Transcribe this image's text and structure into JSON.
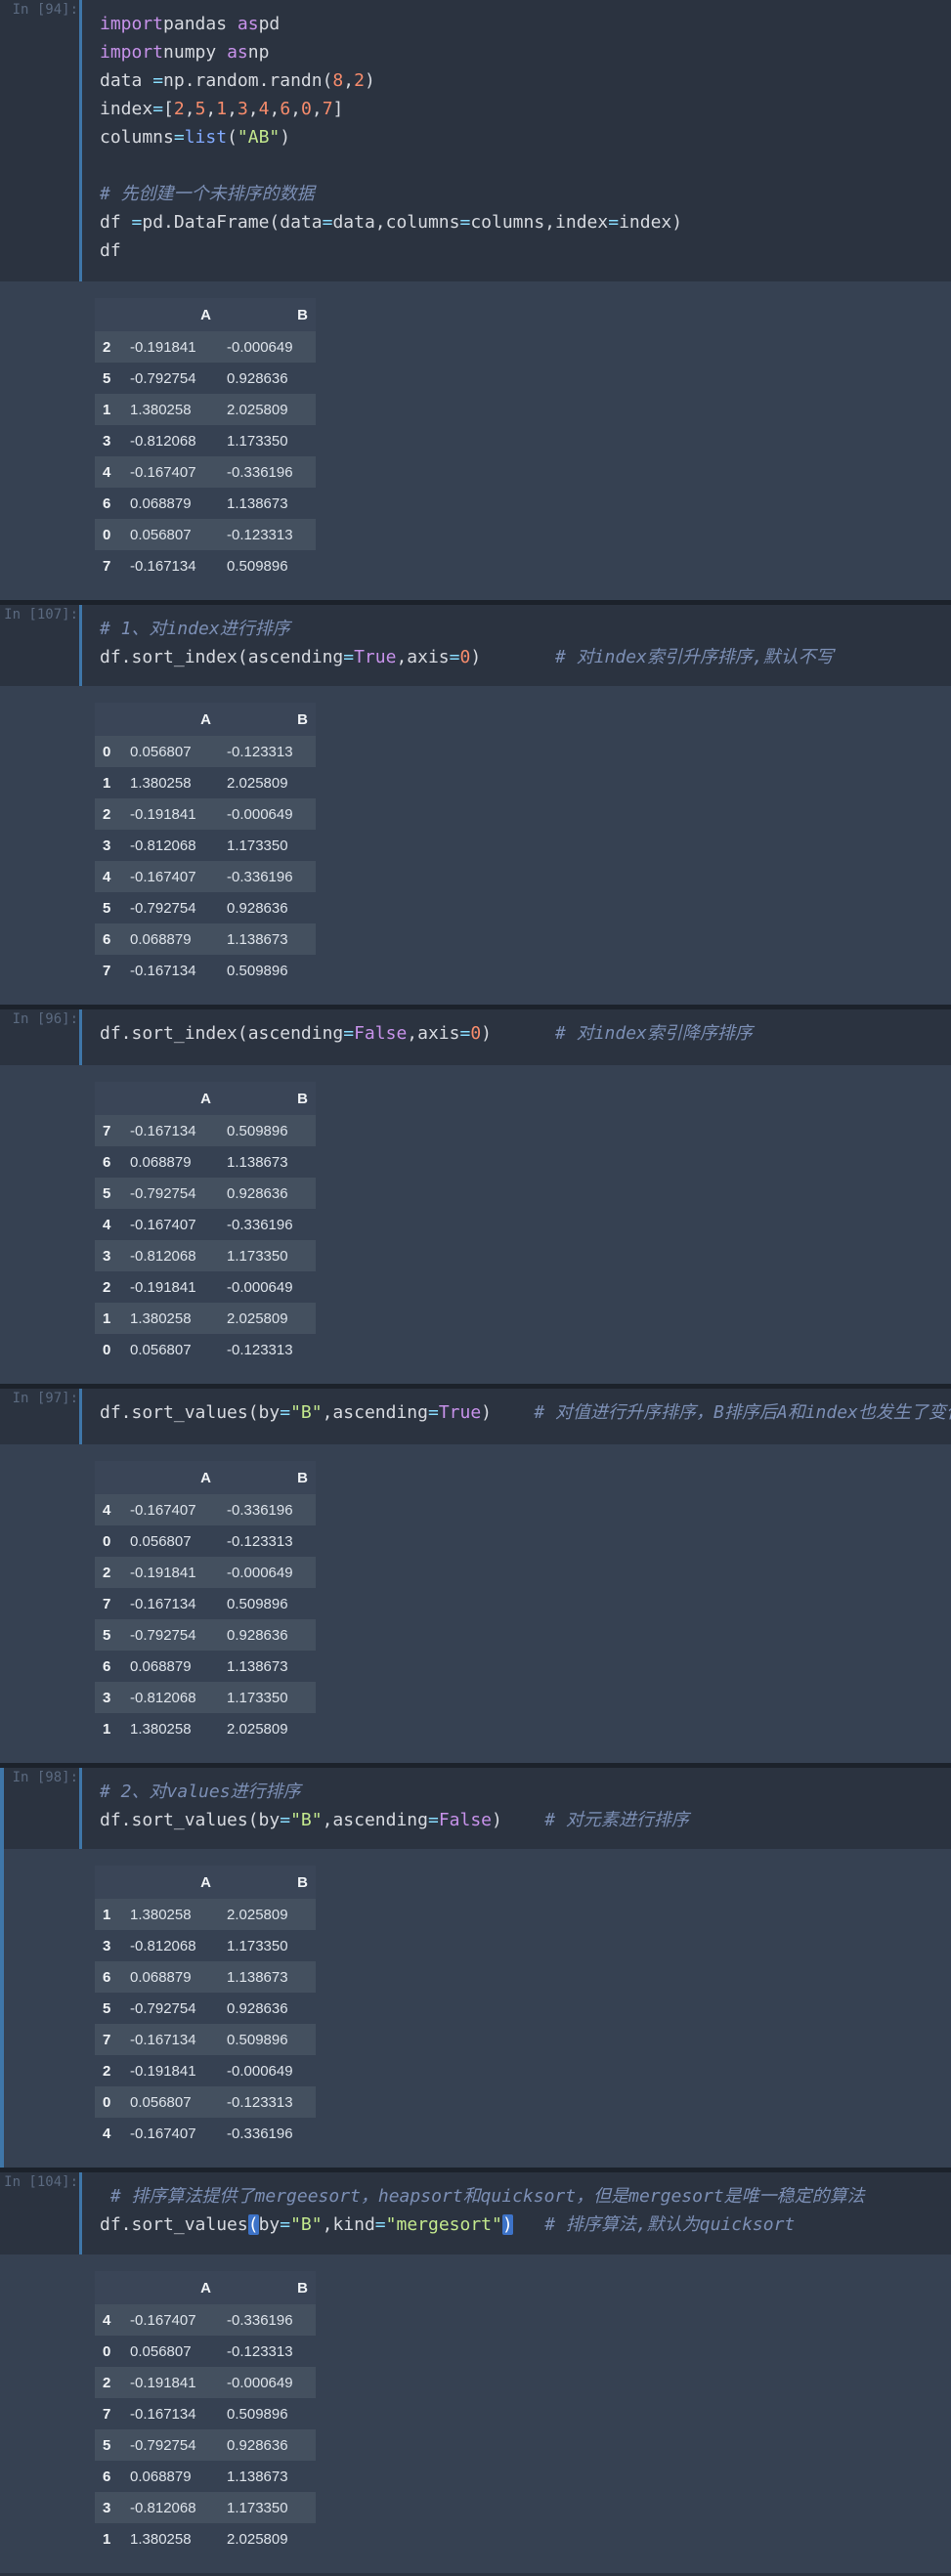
{
  "cells": [
    {
      "prompt": "In [94]:",
      "code": [
        [
          [
            "kw",
            "import"
          ],
          [
            "",
            "pandas "
          ],
          [
            "kw",
            "as"
          ],
          [
            "",
            "pd"
          ]
        ],
        [
          [
            "kw",
            "import"
          ],
          [
            "",
            "numpy "
          ],
          [
            "kw",
            "as"
          ],
          [
            "",
            "np"
          ]
        ],
        [
          [
            "",
            "data "
          ],
          [
            "op",
            "="
          ],
          [
            "",
            "np.random.randn("
          ],
          [
            "num",
            "8"
          ],
          [
            "",
            ","
          ],
          [
            "num",
            "2"
          ],
          [
            "",
            ")"
          ]
        ],
        [
          [
            "",
            "index"
          ],
          [
            "op",
            "="
          ],
          [
            "",
            "["
          ],
          [
            "num",
            "2"
          ],
          [
            "",
            ","
          ],
          [
            "num",
            "5"
          ],
          [
            "",
            ","
          ],
          [
            "num",
            "1"
          ],
          [
            "",
            ","
          ],
          [
            "num",
            "3"
          ],
          [
            "",
            ","
          ],
          [
            "num",
            "4"
          ],
          [
            "",
            ","
          ],
          [
            "num",
            "6"
          ],
          [
            "",
            ","
          ],
          [
            "num",
            "0"
          ],
          [
            "",
            ","
          ],
          [
            "num",
            "7"
          ],
          [
            "",
            "]"
          ]
        ],
        [
          [
            "",
            "columns"
          ],
          [
            "op",
            "="
          ],
          [
            "fn",
            "list"
          ],
          [
            "",
            "("
          ],
          [
            "str",
            "\"AB\""
          ],
          [
            "",
            ")"
          ]
        ],
        [],
        [
          [
            "cm",
            "# 先创建一个未排序的数据"
          ]
        ],
        [
          [
            "",
            "df "
          ],
          [
            "op",
            "="
          ],
          [
            "",
            "pd.DataFrame(data"
          ],
          [
            "op",
            "="
          ],
          [
            "",
            "data,columns"
          ],
          [
            "op",
            "="
          ],
          [
            "",
            "columns,index"
          ],
          [
            "op",
            "="
          ],
          [
            "",
            "index)"
          ]
        ],
        [
          [
            "",
            "df"
          ]
        ]
      ],
      "table": {
        "columns": [
          "A",
          "B"
        ],
        "rows": [
          [
            "2",
            "-0.191841",
            "-0.000649"
          ],
          [
            "5",
            "-0.792754",
            "0.928636"
          ],
          [
            "1",
            "1.380258",
            "2.025809"
          ],
          [
            "3",
            "-0.812068",
            "1.173350"
          ],
          [
            "4",
            "-0.167407",
            "-0.336196"
          ],
          [
            "6",
            "0.068879",
            "1.138673"
          ],
          [
            "0",
            "0.056807",
            "-0.123313"
          ],
          [
            "7",
            "-0.167134",
            "0.509896"
          ]
        ]
      }
    },
    {
      "prompt": "In [107]:",
      "code": [
        [
          [
            "cm",
            "# 1、对index进行排序"
          ]
        ],
        [
          [
            "",
            "df.sort_index(ascending"
          ],
          [
            "op",
            "="
          ],
          [
            "bool",
            "True"
          ],
          [
            "",
            ",axis"
          ],
          [
            "op",
            "="
          ],
          [
            "num",
            "0"
          ],
          [
            "",
            ")       "
          ],
          [
            "cm",
            "# 对index索引升序排序,默认不写"
          ]
        ]
      ],
      "table": {
        "columns": [
          "A",
          "B"
        ],
        "rows": [
          [
            "0",
            "0.056807",
            "-0.123313"
          ],
          [
            "1",
            "1.380258",
            "2.025809"
          ],
          [
            "2",
            "-0.191841",
            "-0.000649"
          ],
          [
            "3",
            "-0.812068",
            "1.173350"
          ],
          [
            "4",
            "-0.167407",
            "-0.336196"
          ],
          [
            "5",
            "-0.792754",
            "0.928636"
          ],
          [
            "6",
            "0.068879",
            "1.138673"
          ],
          [
            "7",
            "-0.167134",
            "0.509896"
          ]
        ]
      }
    },
    {
      "prompt": "In [96]:",
      "code": [
        [
          [
            "",
            "df.sort_index(ascending"
          ],
          [
            "op",
            "="
          ],
          [
            "bool",
            "False"
          ],
          [
            "",
            ",axis"
          ],
          [
            "op",
            "="
          ],
          [
            "num",
            "0"
          ],
          [
            "",
            ")      "
          ],
          [
            "cm",
            "# 对index索引降序排序"
          ]
        ]
      ],
      "table": {
        "columns": [
          "A",
          "B"
        ],
        "rows": [
          [
            "7",
            "-0.167134",
            "0.509896"
          ],
          [
            "6",
            "0.068879",
            "1.138673"
          ],
          [
            "5",
            "-0.792754",
            "0.928636"
          ],
          [
            "4",
            "-0.167407",
            "-0.336196"
          ],
          [
            "3",
            "-0.812068",
            "1.173350"
          ],
          [
            "2",
            "-0.191841",
            "-0.000649"
          ],
          [
            "1",
            "1.380258",
            "2.025809"
          ],
          [
            "0",
            "0.056807",
            "-0.123313"
          ]
        ]
      }
    },
    {
      "prompt": "In [97]:",
      "code": [
        [
          [
            "",
            "df.sort_values(by"
          ],
          [
            "op",
            "="
          ],
          [
            "str",
            "\"B\""
          ],
          [
            "",
            ",ascending"
          ],
          [
            "op",
            "="
          ],
          [
            "bool",
            "True"
          ],
          [
            "",
            ")    "
          ],
          [
            "cm",
            "# 对值进行升序排序，B排序后A和index也发生了变化"
          ]
        ]
      ],
      "table": {
        "columns": [
          "A",
          "B"
        ],
        "rows": [
          [
            "4",
            "-0.167407",
            "-0.336196"
          ],
          [
            "0",
            "0.056807",
            "-0.123313"
          ],
          [
            "2",
            "-0.191841",
            "-0.000649"
          ],
          [
            "7",
            "-0.167134",
            "0.509896"
          ],
          [
            "5",
            "-0.792754",
            "0.928636"
          ],
          [
            "6",
            "0.068879",
            "1.138673"
          ],
          [
            "3",
            "-0.812068",
            "1.173350"
          ],
          [
            "1",
            "1.380258",
            "2.025809"
          ]
        ]
      }
    },
    {
      "prompt": "In [98]:",
      "code": [
        [
          [
            "cm",
            "# 2、对values进行排序"
          ]
        ],
        [
          [
            "",
            "df.sort_values(by"
          ],
          [
            "op",
            "="
          ],
          [
            "str",
            "\"B\""
          ],
          [
            "",
            ",ascending"
          ],
          [
            "op",
            "="
          ],
          [
            "bool",
            "False"
          ],
          [
            "",
            ")    "
          ],
          [
            "cm",
            "# 对元素进行排序"
          ]
        ]
      ],
      "table": {
        "columns": [
          "A",
          "B"
        ],
        "rows": [
          [
            "1",
            "1.380258",
            "2.025809"
          ],
          [
            "3",
            "-0.812068",
            "1.173350"
          ],
          [
            "6",
            "0.068879",
            "1.138673"
          ],
          [
            "5",
            "-0.792754",
            "0.928636"
          ],
          [
            "7",
            "-0.167134",
            "0.509896"
          ],
          [
            "2",
            "-0.191841",
            "-0.000649"
          ],
          [
            "0",
            "0.056807",
            "-0.123313"
          ],
          [
            "4",
            "-0.167407",
            "-0.336196"
          ]
        ]
      }
    },
    {
      "prompt": "In [104]:",
      "code": [
        [
          [
            "cm",
            " # 排序算法提供了mergeesort，heapsort和quicksort，但是mergesort是唯一稳定的算法"
          ]
        ],
        [
          [
            "",
            "df.sort_values"
          ],
          [
            "hl",
            "("
          ],
          [
            "",
            "by"
          ],
          [
            "op",
            "="
          ],
          [
            "str",
            "\"B\""
          ],
          [
            "",
            ",kind"
          ],
          [
            "op",
            "="
          ],
          [
            "str",
            "\"mergesort\""
          ],
          [
            "hl",
            ")"
          ],
          [
            "",
            "   "
          ],
          [
            "cm",
            "# 排序算法,默认为quicksort"
          ]
        ]
      ],
      "table": {
        "columns": [
          "A",
          "B"
        ],
        "rows": [
          [
            "4",
            "-0.167407",
            "-0.336196"
          ],
          [
            "0",
            "0.056807",
            "-0.123313"
          ],
          [
            "2",
            "-0.191841",
            "-0.000649"
          ],
          [
            "7",
            "-0.167134",
            "0.509896"
          ],
          [
            "5",
            "-0.792754",
            "0.928636"
          ],
          [
            "6",
            "0.068879",
            "1.138673"
          ],
          [
            "3",
            "-0.812068",
            "1.173350"
          ],
          [
            "1",
            "1.380258",
            "2.025809"
          ]
        ]
      }
    }
  ]
}
